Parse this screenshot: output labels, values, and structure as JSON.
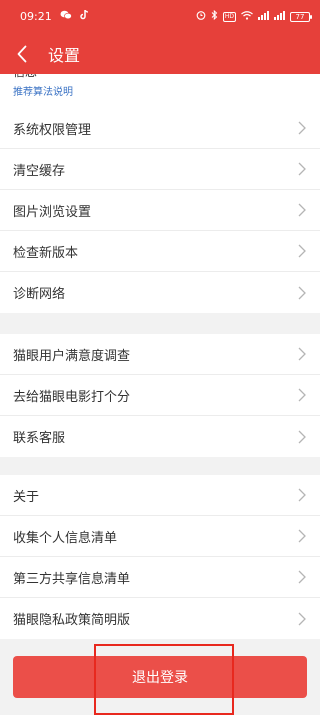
{
  "status_bar": {
    "time": "09:21",
    "battery": "77",
    "hd": "HD"
  },
  "header": {
    "title": "设置"
  },
  "partial_item": {
    "label": "信息",
    "link": "推荐算法说明"
  },
  "group1": {
    "items": [
      {
        "label": "系统权限管理"
      },
      {
        "label": "清空缓存"
      },
      {
        "label": "图片浏览设置"
      },
      {
        "label": "检查新版本"
      },
      {
        "label": "诊断网络"
      }
    ]
  },
  "group2": {
    "items": [
      {
        "label": "猫眼用户满意度调查"
      },
      {
        "label": "去给猫眼电影打个分"
      },
      {
        "label": "联系客服"
      }
    ]
  },
  "group3": {
    "items": [
      {
        "label": "关于"
      },
      {
        "label": "收集个人信息清单"
      },
      {
        "label": "第三方共享信息清单"
      },
      {
        "label": "猫眼隐私政策简明版"
      }
    ]
  },
  "logout": {
    "label": "退出登录"
  },
  "colors": {
    "brand_red": "#e6403a",
    "button_red": "#eb4f49",
    "link_blue": "#3a72c4",
    "highlight": "#e8281e"
  }
}
